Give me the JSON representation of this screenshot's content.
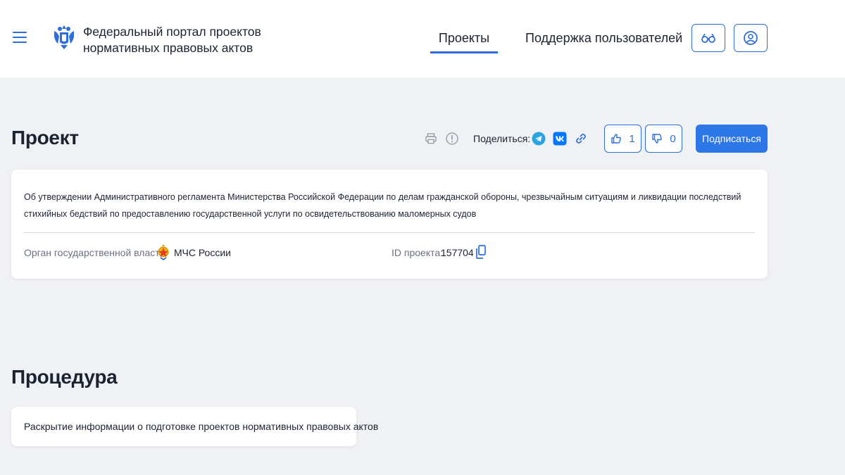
{
  "header": {
    "portal_title_line1": "Федеральный портал проектов",
    "portal_title_line2": "нормативных правовых актов",
    "nav": [
      {
        "label": "Проекты",
        "active": true
      },
      {
        "label": "Поддержка пользователей",
        "active": false
      }
    ],
    "icons": {
      "menu": "hamburger-menu-icon",
      "emblem": "coat-of-arms-icon",
      "accessibility": "glasses-icon",
      "account": "user-icon"
    }
  },
  "project": {
    "section_title": "Проект",
    "toolbar": {
      "share_label": "Поделиться:",
      "likes": "1",
      "dislikes": "0",
      "subscribe_label": "Подписаться"
    },
    "description": "Об утверждении Административного регламента Министерства Российской Федерации по делам гражданской обороны, чрезвычайным ситуациям и ликвидации последствий стихийных бедствий по предоставлению государственной услуги по освидетельствованию маломерных судов",
    "authority_label": "Орган государственной власти:",
    "authority_value": "МЧС России",
    "id_label": "ID проекта:",
    "id_value": "157704"
  },
  "procedure": {
    "section_title": "Процедура",
    "text": "Раскрытие информации о подготовке проектов нормативных правовых актов"
  },
  "colors": {
    "accent": "#2c6fdb",
    "primary_button": "#2c76e8",
    "page_background": "#f0f1f4",
    "telegram": "#2aa3e0",
    "vk": "#0077ff"
  }
}
